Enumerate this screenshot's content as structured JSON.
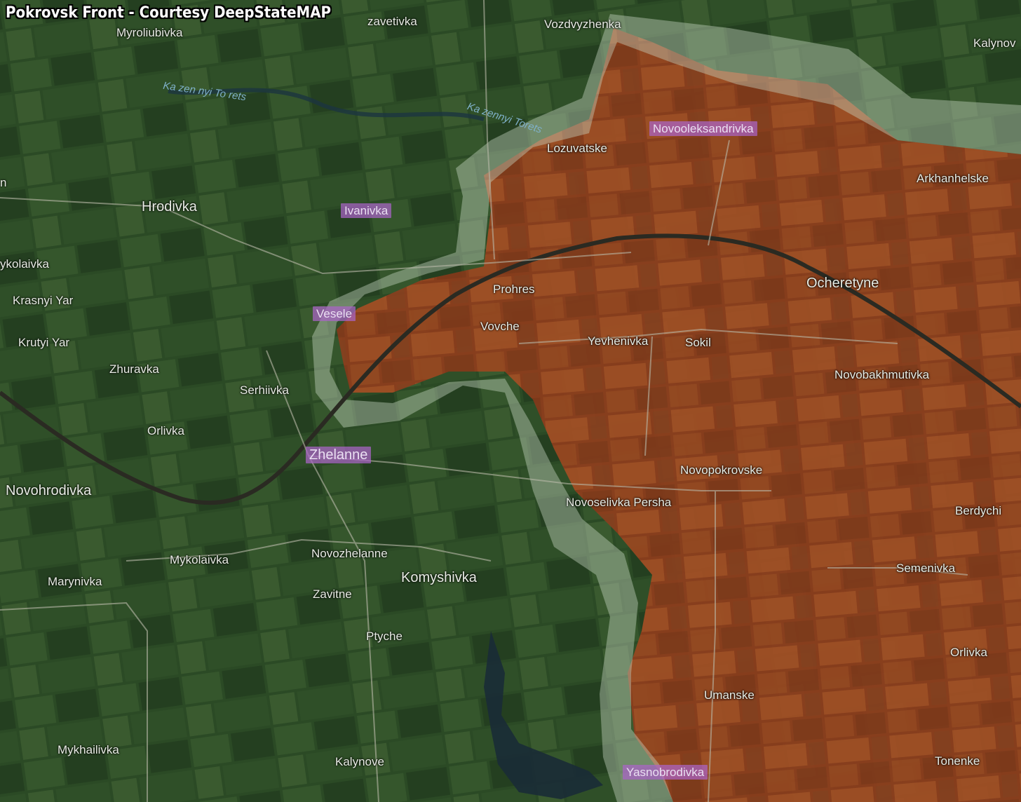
{
  "title": "Pokrovsk Front - Courtesy DeepStateMAP",
  "colors": {
    "terrain": "#2c4a26",
    "occupied_zone": "#a0451e",
    "gray_zone": "#c9d6c4",
    "highlight_label": "#aa64c8",
    "railway": "#2a2a22",
    "road": "#b9b9a9",
    "water": "#1a2b36"
  },
  "rivers": {
    "kazennyi_torets_1": "Ka zen nyi To rets",
    "kazennyi_torets_2": "Ka zennyi Torets"
  },
  "places": {
    "myroliubivka": "Myroliubivka",
    "zavetivka": "zavetivka",
    "vozdvyzhenka": "Vozdvyzhenka",
    "kalynove_top": "Kalynov",
    "novooleksandrivka": "Novooleksandrivka",
    "lozuvatske": "Lozuvatske",
    "arkhanhelske": "Arkhanhelske",
    "hrodivka": "Hrodivka",
    "ivanivka": "Ivanivka",
    "mykolaivka_left": "ykolaivka",
    "krasnyi_yar": "Krasnyi Yar",
    "prohres": "Prohres",
    "ocheretyne": "Ocheretyne",
    "vesele": "Vesele",
    "vovche": "Vovche",
    "yevhenivka": "Yevhenivka",
    "sokil": "Sokil",
    "krutyi_yar": "Krutyi Yar",
    "zhuravka": "Zhuravka",
    "novobakhmutivka": "Novobakhmutivka",
    "serhiivka": "Serhiivka",
    "orlivka_left": "Orlivka",
    "zhelanne": "Zhelanne",
    "novopokrovske": "Novopokrovske",
    "novohrodivka": "Novohrodivka",
    "novoselivka_persha": "Novoselivka Persha",
    "berdychi": "Berdychi",
    "mykolaivka": "Mykolaivka",
    "novozhelanne": "Novozhelanne",
    "marynivka": "Marynivka",
    "komyshivka": "Komyshivka",
    "semenivka": "Semenivka",
    "zavitne": "Zavitne",
    "ptyche": "Ptyche",
    "orlivka_right": "Orlivka",
    "umanske": "Umanske",
    "mykhailivka": "Mykhailivka",
    "kalynove": "Kalynove",
    "tonenke": "Tonenke",
    "yasnobrodivka": "Yasnobrodivka",
    "edge_left": "n"
  }
}
